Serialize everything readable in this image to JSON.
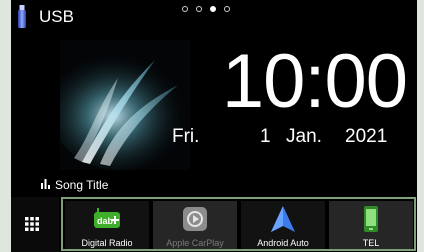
{
  "header": {
    "source_label": "USB",
    "page_dots": 4,
    "active_page": 3
  },
  "clock": {
    "time": "10:00",
    "day_of_week": "Fri.",
    "day": "1",
    "month": "Jan.",
    "year": "2021"
  },
  "now_playing": {
    "song_title": "Song Title"
  },
  "shortcuts": [
    {
      "label": "Digital Radio",
      "icon": "dab-radio-icon",
      "enabled": true
    },
    {
      "label": "Apple CarPlay",
      "icon": "carplay-icon",
      "enabled": false
    },
    {
      "label": "Android Auto",
      "icon": "android-auto-icon",
      "enabled": true
    },
    {
      "label": "TEL",
      "icon": "phone-icon",
      "enabled": true
    }
  ],
  "colors": {
    "background": "#000000",
    "frame": "#dfe6dd",
    "shortcut_border": "#7fa07a",
    "dab_green": "#3fae2a",
    "android_blue": "#3b7bea"
  }
}
